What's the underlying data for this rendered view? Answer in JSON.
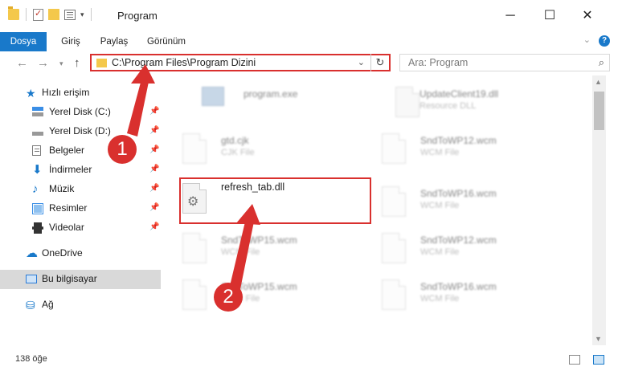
{
  "window": {
    "title": "Program",
    "minimize": "─",
    "maximize": "☐",
    "close": "✕"
  },
  "ribbon": {
    "tabs": [
      "Dosya",
      "Giriş",
      "Paylaş",
      "Görünüm"
    ],
    "help": "?"
  },
  "address": {
    "path": "C:\\Program Files\\Program Dizini"
  },
  "search": {
    "placeholder": "Ara: Program"
  },
  "sidebar": {
    "items": [
      {
        "label": "Hızlı erişim",
        "icon": "star-icon"
      },
      {
        "label": "Yerel Disk (C:)",
        "icon": "disk-icon"
      },
      {
        "label": "Yerel Disk (D:)",
        "icon": "disk-icon"
      },
      {
        "label": "Belgeler",
        "icon": "document-icon"
      },
      {
        "label": "İndirmeler",
        "icon": "download-icon"
      },
      {
        "label": "Müzik",
        "icon": "music-icon"
      },
      {
        "label": "Resimler",
        "icon": "pictures-icon"
      },
      {
        "label": "Videolar",
        "icon": "video-icon"
      },
      {
        "label": "OneDrive",
        "icon": "cloud-icon"
      },
      {
        "label": "Bu bilgisayar",
        "icon": "computer-icon"
      },
      {
        "label": "Ağ",
        "icon": "network-icon"
      }
    ]
  },
  "files": [
    {
      "name": "program.exe",
      "type": ""
    },
    {
      "name": "UpdateClient19.dll",
      "type": "Resource DLL"
    },
    {
      "name": "gtd.cjk",
      "type": "CJK File"
    },
    {
      "name": "SndToWP12.wcm",
      "type": "WCM File"
    },
    {
      "name": "refresh_tab.dll",
      "type": ""
    },
    {
      "name": "SndToWP16.wcm",
      "type": "WCM File"
    },
    {
      "name": "SndToWP15.wcm",
      "type": "WCM File"
    },
    {
      "name": "SndToWP12.wcm",
      "type": "WCM File"
    },
    {
      "name": "SndToWP15.wcm",
      "type": "WCM File"
    },
    {
      "name": "SndToWP16.wcm",
      "type": "WCM File"
    }
  ],
  "status": {
    "count": "138 öğe"
  },
  "annotations": {
    "badge1": "1",
    "badge2": "2",
    "color": "#d9302e"
  }
}
